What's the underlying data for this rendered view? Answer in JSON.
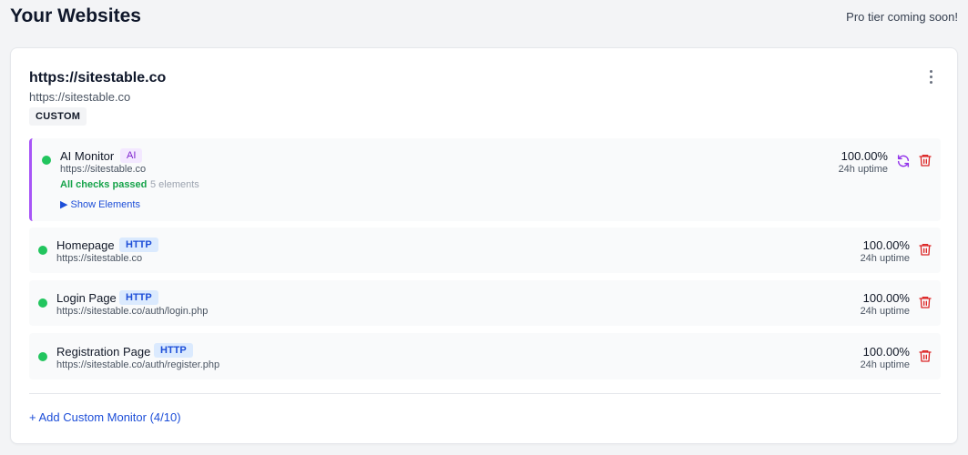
{
  "header": {
    "title": "Your Websites",
    "pro_note": "Pro tier coming soon!"
  },
  "site": {
    "title": "https://sitestable.co",
    "url": "https://sitestable.co",
    "badge": "CUSTOM"
  },
  "ai_monitor": {
    "name": "AI Monitor",
    "type": "AI",
    "url": "https://sitestable.co",
    "checks_status": "All checks passed",
    "elements_count": "5 elements",
    "show_elements": "▶ Show Elements",
    "uptime": "100.00%",
    "uptime_label": "24h uptime",
    "status_color": "#22c55e",
    "accent_color": "#a855f7"
  },
  "monitors": [
    {
      "name": "Homepage",
      "type": "HTTP",
      "url": "https://sitestable.co",
      "uptime": "100.00%",
      "uptime_label": "24h uptime"
    },
    {
      "name": "Login Page",
      "type": "HTTP",
      "url": "https://sitestable.co/auth/login.php",
      "uptime": "100.00%",
      "uptime_label": "24h uptime"
    },
    {
      "name": "Registration Page",
      "type": "HTTP",
      "url": "https://sitestable.co/auth/register.php",
      "uptime": "100.00%",
      "uptime_label": "24h uptime"
    }
  ],
  "footer": {
    "add_label": "+ Add Custom Monitor (4/10)"
  },
  "icons": {
    "menu": "more-vertical-icon",
    "refresh": "refresh-icon",
    "delete": "trash-icon"
  },
  "colors": {
    "status_up": "#22c55e",
    "link": "#1d4ed8",
    "delete": "#dc2626",
    "refresh": "#9333ea"
  }
}
